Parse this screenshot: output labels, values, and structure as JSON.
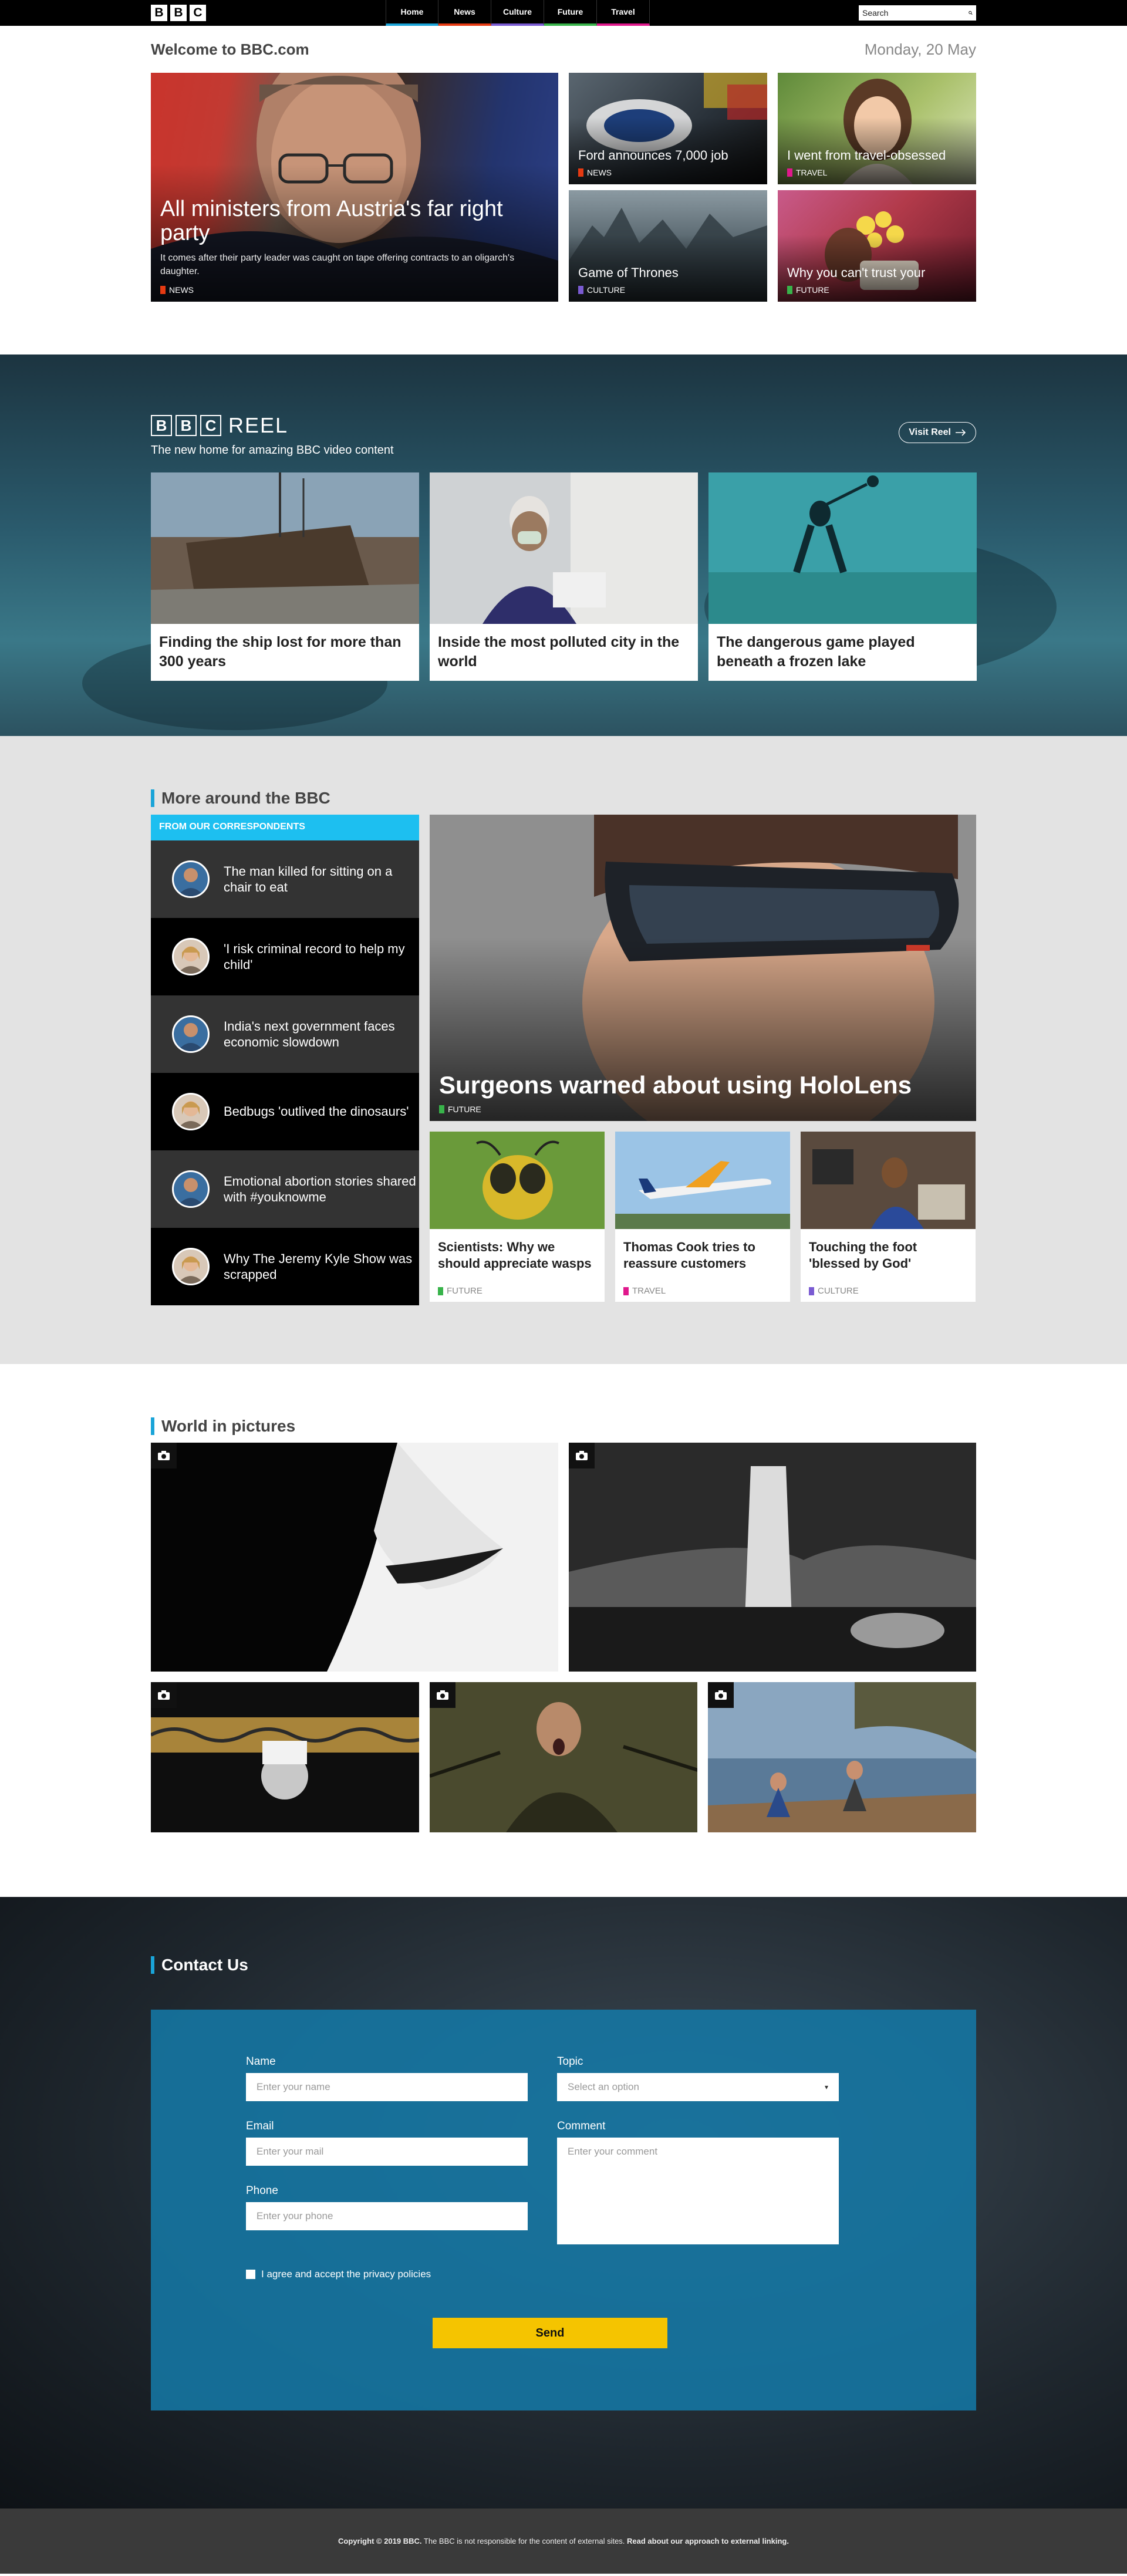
{
  "header": {
    "logo_letters": [
      "B",
      "B",
      "C"
    ],
    "nav": [
      {
        "label": "Home",
        "color": "#1aa4d8"
      },
      {
        "label": "News",
        "color": "#e63a12"
      },
      {
        "label": "Culture",
        "color": "#7a5bd2"
      },
      {
        "label": "Future",
        "color": "#38b34a"
      },
      {
        "label": "Travel",
        "color": "#e0188c"
      }
    ],
    "search_placeholder": "Search",
    "search_icon": "search-icon"
  },
  "welcome": {
    "title": "Welcome to BBC.com",
    "date": "Monday, 20 May",
    "main_story": {
      "headline": "All ministers from Austria's far right party",
      "summary": "It comes after their party leader was caught on tape offering contracts to an oligarch's daughter.",
      "tag": "NEWS",
      "tag_color": "#e63a12"
    },
    "stories": [
      {
        "headline": "Ford announces 7,000 job",
        "tag": "NEWS",
        "tag_color": "#e63a12"
      },
      {
        "headline": "I went from travel-obsessed",
        "tag": "TRAVEL",
        "tag_color": "#e0188c"
      },
      {
        "headline": "Game of Thrones",
        "tag": "CULTURE",
        "tag_color": "#7a5bd2"
      },
      {
        "headline": "Why you can't trust your",
        "tag": "FUTURE",
        "tag_color": "#38b34a"
      }
    ]
  },
  "reel": {
    "logo_word": "REEL",
    "subtitle": "The new home for amazing BBC video content",
    "visit_label": "Visit Reel",
    "videos": [
      {
        "title": "Finding the ship lost for more than 300 years"
      },
      {
        "title": "Inside the most polluted city in the world"
      },
      {
        "title": "The dangerous game played beneath a frozen lake"
      }
    ]
  },
  "more": {
    "title": "More around the BBC",
    "correspondents_label": "FROM OUR CORRESPONDENTS",
    "correspondents": [
      {
        "text": "The man killed for sitting on a chair to eat"
      },
      {
        "text": "'I risk criminal record to help my child'"
      },
      {
        "text": "India's next government faces economic slowdown"
      },
      {
        "text": "Bedbugs 'outlived the dinosaurs'"
      },
      {
        "text": "Emotional abortion stories shared with #youknowme"
      },
      {
        "text": "Why The Jeremy Kyle Show was scrapped"
      }
    ],
    "feature": {
      "headline": "Surgeons warned about using HoloLens",
      "tag": "FUTURE",
      "tag_color": "#38b34a"
    },
    "cards": [
      {
        "headline": "Scientists: Why we should appreciate wasps",
        "tag": "FUTURE",
        "tag_color": "#38b34a"
      },
      {
        "headline": "Thomas Cook tries to reassure customers",
        "tag": "TRAVEL",
        "tag_color": "#e0188c"
      },
      {
        "headline": "Touching the foot 'blessed by God'",
        "tag": "CULTURE",
        "tag_color": "#7a5bd2"
      }
    ]
  },
  "world": {
    "title": "World in pictures"
  },
  "contact": {
    "title": "Contact Us",
    "name_label": "Name",
    "name_placeholder": "Enter your name",
    "email_label": "Email",
    "email_placeholder": "Enter your mail",
    "phone_label": "Phone",
    "phone_placeholder": "Enter your phone",
    "topic_label": "Topic",
    "topic_placeholder": "Select an option",
    "comment_label": "Comment",
    "comment_placeholder": "Enter your comment",
    "agree_text": "I agree and accept the privacy policies",
    "send_label": "Send"
  },
  "footer": {
    "copyright": "Copyright © 2019 BBC.",
    "disclaimer": " The BBC is not responsible for the content of external sites. ",
    "link": "Read about our approach to external linking."
  }
}
